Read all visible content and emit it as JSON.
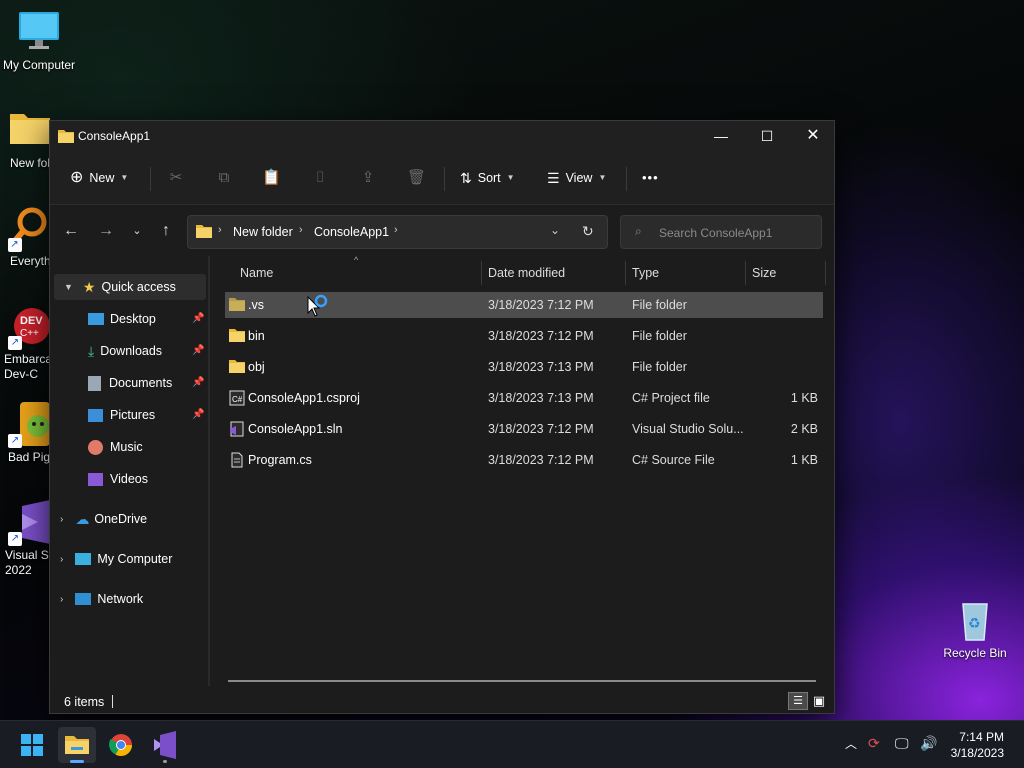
{
  "desktop": {
    "icons": [
      {
        "label": "My Computer"
      },
      {
        "label": "New fol"
      },
      {
        "label": "Everyth"
      },
      {
        "label": "Embarca Dev-C"
      },
      {
        "label": "Bad Pig"
      },
      {
        "label": "Visual St 2022"
      },
      {
        "label": "Recycle Bin"
      }
    ]
  },
  "window": {
    "title": "ConsoleApp1",
    "toolbar": {
      "new_label": "New",
      "sort_label": "Sort",
      "view_label": "View",
      "more_label": "•••"
    },
    "address": {
      "crumbs": [
        "New folder",
        "ConsoleApp1"
      ]
    },
    "search": {
      "placeholder": "Search ConsoleApp1"
    },
    "sidebar": {
      "quick_access": "Quick access",
      "items": [
        {
          "label": "Desktop",
          "pinned": true
        },
        {
          "label": "Downloads",
          "pinned": true
        },
        {
          "label": "Documents",
          "pinned": true
        },
        {
          "label": "Pictures",
          "pinned": true
        },
        {
          "label": "Music",
          "pinned": false
        },
        {
          "label": "Videos",
          "pinned": false
        }
      ],
      "roots": [
        {
          "label": "OneDrive"
        },
        {
          "label": "My Computer"
        },
        {
          "label": "Network"
        }
      ]
    },
    "columns": {
      "name": "Name",
      "date": "Date modified",
      "type": "Type",
      "size": "Size"
    },
    "files": [
      {
        "name": ".vs",
        "date": "3/18/2023 7:12 PM",
        "type": "File folder",
        "size": "",
        "kind": "folder-dim",
        "selected": true
      },
      {
        "name": "bin",
        "date": "3/18/2023 7:12 PM",
        "type": "File folder",
        "size": "",
        "kind": "folder"
      },
      {
        "name": "obj",
        "date": "3/18/2023 7:13 PM",
        "type": "File folder",
        "size": "",
        "kind": "folder"
      },
      {
        "name": "ConsoleApp1.csproj",
        "date": "3/18/2023 7:13 PM",
        "type": "C# Project file",
        "size": "1 KB",
        "kind": "csproj"
      },
      {
        "name": "ConsoleApp1.sln",
        "date": "3/18/2023 7:12 PM",
        "type": "Visual Studio Solu...",
        "size": "2 KB",
        "kind": "sln"
      },
      {
        "name": "Program.cs",
        "date": "3/18/2023 7:12 PM",
        "type": "C# Source File",
        "size": "1 KB",
        "kind": "cs"
      }
    ],
    "status": {
      "count": "6 items"
    }
  },
  "taskbar": {
    "time": "7:14 PM",
    "date": "3/18/2023"
  },
  "colors": {
    "window_bg": "#1c1c1c",
    "selection": "#4d4d4d",
    "folder": "#f2c94c",
    "accent": "#0078d4"
  }
}
